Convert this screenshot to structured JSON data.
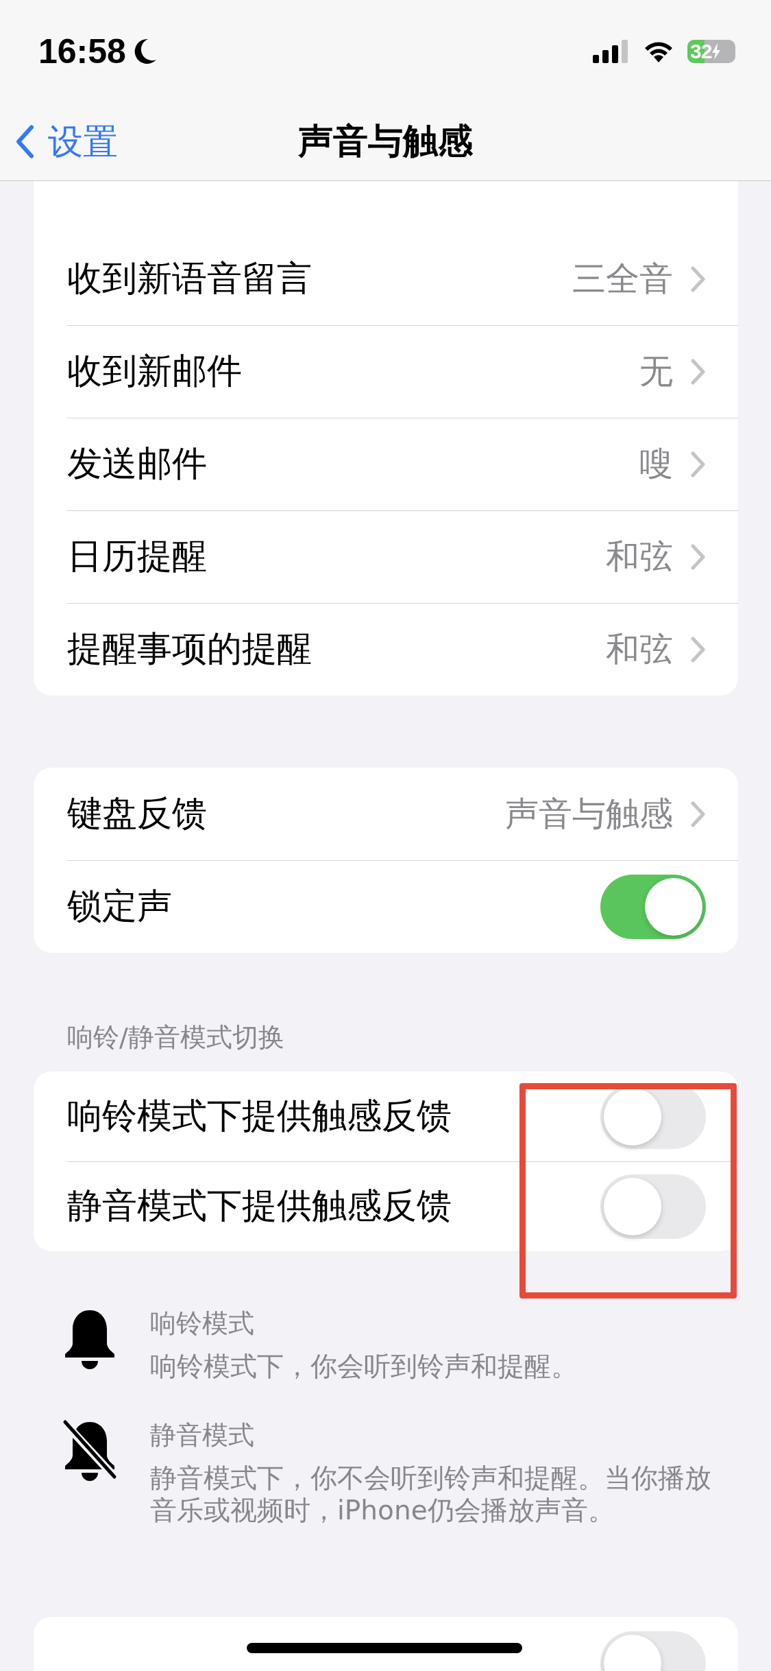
{
  "status_bar": {
    "time": "16:58",
    "battery": "32"
  },
  "nav": {
    "back": "设置",
    "title": "声音与触感"
  },
  "sections": [
    {
      "rows": [
        {
          "kind": "link",
          "label": "收到新语音留言",
          "value": "三全音"
        },
        {
          "kind": "link",
          "label": "收到新邮件",
          "value": "无"
        },
        {
          "kind": "link",
          "label": "发送邮件",
          "value": "嗖"
        },
        {
          "kind": "link",
          "label": "日历提醒",
          "value": "和弦"
        },
        {
          "kind": "link",
          "label": "提醒事项的提醒",
          "value": "和弦"
        }
      ]
    },
    {
      "rows": [
        {
          "kind": "link",
          "label": "键盘反馈",
          "value": "声音与触感"
        },
        {
          "kind": "toggle",
          "label": "锁定声",
          "on": true
        }
      ]
    },
    {
      "header": "响铃/静音模式切换",
      "rows": [
        {
          "kind": "toggle",
          "label": "响铃模式下提供触感反馈",
          "on": false
        },
        {
          "kind": "toggle",
          "label": "静音模式下提供触感反馈",
          "on": false
        }
      ],
      "notes": [
        {
          "kind": "ring",
          "title": "响铃模式",
          "text": "响铃模式下，你会听到铃声和提醒。"
        },
        {
          "kind": "silent",
          "title": "静音模式",
          "text": "静音模式下，你不会听到铃声和提醒。当你播放音乐或视频时，iPhone仍会播放声音。"
        }
      ]
    },
    {
      "rows": [
        {
          "kind": "toggle",
          "on": false
        }
      ]
    }
  ],
  "highlight": {
    "kind": "rectangle"
  }
}
